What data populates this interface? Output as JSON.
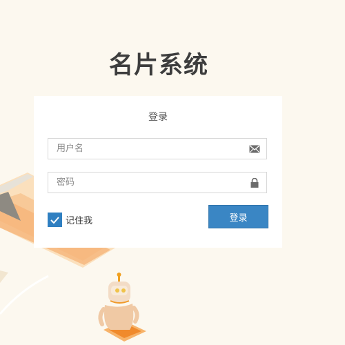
{
  "app": {
    "title": "名片系统"
  },
  "login": {
    "heading": "登录",
    "username_placeholder": "用户名",
    "password_placeholder": "密码",
    "remember_label": "记住我",
    "remember_checked": true,
    "submit_label": "登录"
  },
  "icons": {
    "username": "envelope-icon",
    "password": "lock-icon",
    "checkbox": "checkmark-icon"
  },
  "colors": {
    "background": "#fcf8ef",
    "accent": "#3a86c4",
    "checkbox": "#2f7fc1",
    "title": "#3d3d3d"
  }
}
